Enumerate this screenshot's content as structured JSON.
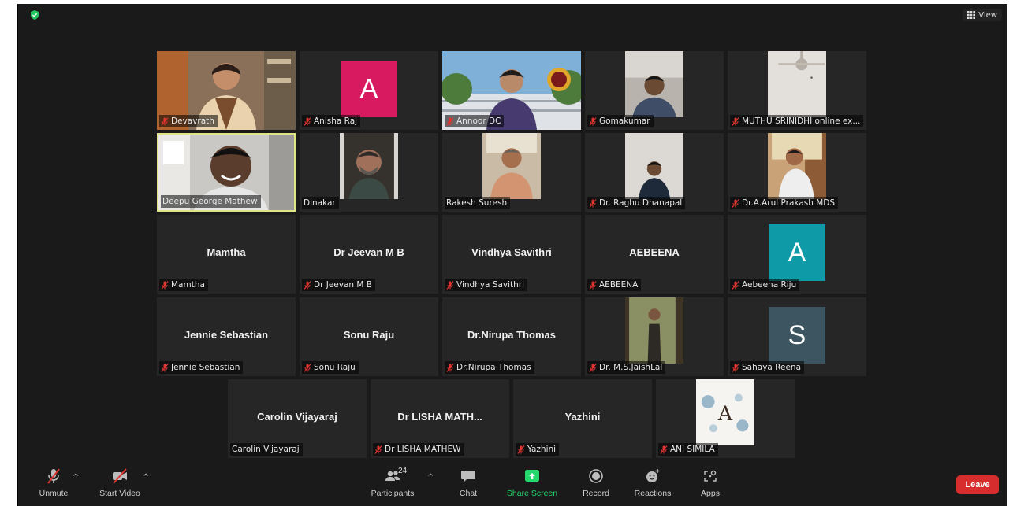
{
  "view_label": "View",
  "rows": [
    [
      {
        "name": "Devavrath",
        "muted": true,
        "type": "photo",
        "photo": "woman-shelves"
      },
      {
        "name": "Anisha Raj",
        "muted": true,
        "type": "letter",
        "letter": "A",
        "color": "#d81b60"
      },
      {
        "name": "Annoor DC",
        "muted": true,
        "type": "photo",
        "photo": "college-bg"
      },
      {
        "name": "Gomakumar",
        "muted": true,
        "type": "photo",
        "photo": "man-room"
      },
      {
        "name": "MUTHU SRINIDHI online ex...",
        "muted": true,
        "type": "photo",
        "photo": "ceiling-fan"
      }
    ],
    [
      {
        "name": "Deepu George Mathew",
        "muted": false,
        "type": "photo",
        "photo": "man-smile",
        "active": true
      },
      {
        "name": "Dinakar",
        "muted": false,
        "type": "photo",
        "photo": "man-beard"
      },
      {
        "name": "Rakesh Suresh",
        "muted": false,
        "type": "photo",
        "photo": "man-office"
      },
      {
        "name": "Dr. Raghu Dhanapal",
        "muted": true,
        "type": "photo",
        "photo": "man-wall"
      },
      {
        "name": "Dr.A.Arul Prakash MDS",
        "muted": true,
        "type": "photo",
        "photo": "man-chair"
      }
    ],
    [
      {
        "name": "Mamtha",
        "muted": true,
        "type": "text",
        "display": "Mamtha"
      },
      {
        "name": "Dr Jeevan M B",
        "muted": true,
        "type": "text",
        "display": "Dr Jeevan M B"
      },
      {
        "name": "Vindhya Savithri",
        "muted": true,
        "type": "text",
        "display": "Vindhya Savithri"
      },
      {
        "name": "AEBEENA",
        "muted": true,
        "type": "text",
        "display": "AEBEENA"
      },
      {
        "name": "Aebeena Riju",
        "muted": true,
        "type": "letter",
        "letter": "A",
        "color": "#0e9aa7"
      }
    ],
    [
      {
        "name": "Jennie Sebastian",
        "muted": true,
        "type": "text",
        "display": "Jennie Sebastian"
      },
      {
        "name": "Sonu Raju",
        "muted": true,
        "type": "text",
        "display": "Sonu Raju"
      },
      {
        "name": "Dr.Nirupa Thomas",
        "muted": true,
        "type": "text",
        "display": "Dr.Nirupa Thomas"
      },
      {
        "name": "Dr. M.S.JaishLal",
        "muted": true,
        "type": "photo",
        "photo": "man-forest"
      },
      {
        "name": "Sahaya Reena",
        "muted": true,
        "type": "letter",
        "letter": "S",
        "color": "#3d5560"
      }
    ],
    [
      {
        "name": "Carolin Vijayaraj",
        "muted": false,
        "type": "text",
        "display": "Carolin Vijayaraj"
      },
      {
        "name": "Dr LISHA MATHEW",
        "muted": true,
        "type": "text",
        "display": "Dr LISHA MATH..."
      },
      {
        "name": "Yazhini",
        "muted": true,
        "type": "text",
        "display": "Yazhini"
      },
      {
        "name": "ANI SIMILA",
        "muted": true,
        "type": "photo",
        "photo": "floral-a"
      }
    ]
  ],
  "toolbar": {
    "unmute": "Unmute",
    "start_video": "Start Video",
    "participants": "Participants",
    "participant_count": "24",
    "chat": "Chat",
    "share_screen": "Share Screen",
    "record": "Record",
    "reactions": "Reactions",
    "apps": "Apps",
    "leave": "Leave"
  },
  "colors": {
    "share_green": "#23d96c",
    "leave_red": "#d72d2d",
    "active_border": "#dfe585"
  }
}
